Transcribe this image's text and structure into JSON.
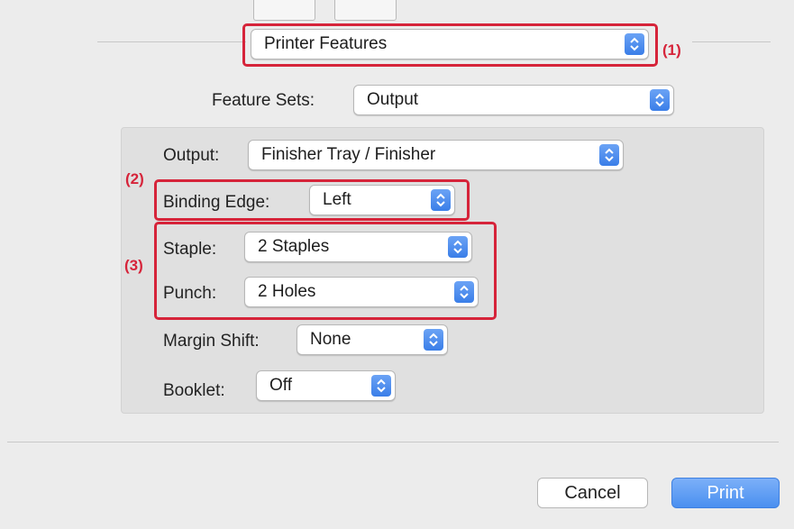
{
  "sheet": {
    "panel_select": {
      "value": "Printer Features"
    },
    "feature_sets": {
      "label": "Feature Sets:",
      "value": "Output"
    }
  },
  "settings": {
    "output": {
      "label": "Output:",
      "value": "Finisher Tray / Finisher"
    },
    "binding_edge": {
      "label": "Binding Edge:",
      "value": "Left"
    },
    "staple": {
      "label": "Staple:",
      "value": "2 Staples"
    },
    "punch": {
      "label": "Punch:",
      "value": "2 Holes"
    },
    "margin_shift": {
      "label": "Margin Shift:",
      "value": "None"
    },
    "booklet": {
      "label": "Booklet:",
      "value": "Off"
    }
  },
  "callouts": {
    "c1": "(1)",
    "c2": "(2)",
    "c3": "(3)"
  },
  "buttons": {
    "cancel": "Cancel",
    "print": "Print"
  },
  "colors": {
    "callout_red": "#d6243a",
    "accent_blue": "#4a8ff0"
  },
  "icons": {
    "popup_arrows": "chevron-up-down-icon"
  }
}
